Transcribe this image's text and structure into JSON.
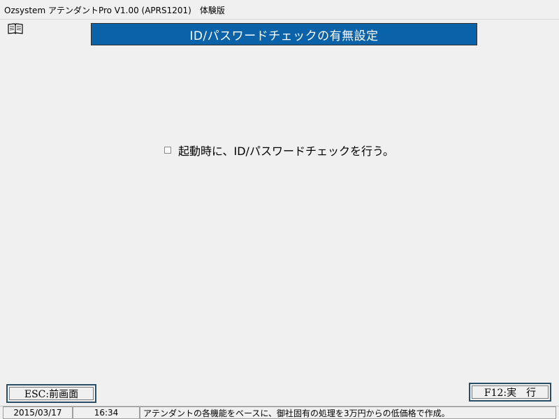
{
  "window": {
    "title": "Ozsystem アテンダントPro V1.00 (APRS1201)　体験版"
  },
  "header": {
    "icon": "book-icon",
    "title": "ID/パスワードチェックの有無設定"
  },
  "main": {
    "option": {
      "label": "起動時に、ID/パスワードチェックを行う。",
      "checked": false
    }
  },
  "buttons": {
    "esc_label": "ESC:前画面",
    "f12_label": "F12:実　行"
  },
  "statusbar": {
    "date": "2015/03/17",
    "time": "16:34",
    "message": "アテンダントの各機能をベースに、御社固有の処理を3万円からの低価格で作成。"
  },
  "colors": {
    "banner": "#0a62a8",
    "background": "#f0f0f0",
    "button_border": "#2a4e66"
  }
}
